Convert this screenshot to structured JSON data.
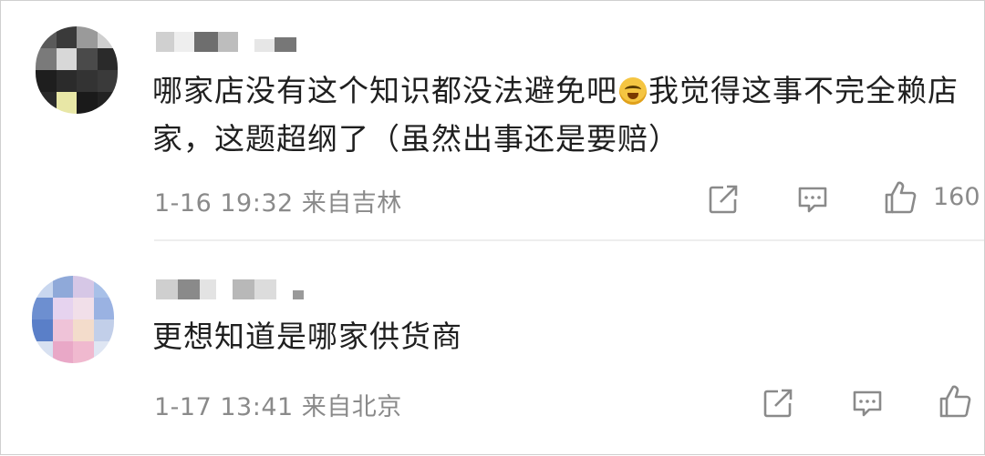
{
  "comments": [
    {
      "text_before_emoji": "哪家店没有这个知识都没法避免吧",
      "emoji": "laugh-cry-emoji",
      "text_after_emoji": "我觉得这事不完全赖店家，这题超纲了（虽然出事还是要赔）",
      "meta": "1-16 19:32 来自吉林",
      "like_count": "160"
    },
    {
      "text_before_emoji": "更想知道是哪家供货商",
      "meta": "1-17 13:41 来自北京",
      "like_count": ""
    }
  ],
  "colors": {
    "text": "#1f1f1f",
    "meta": "#8a8a8a",
    "icon": "#8a8a8a",
    "divider": "#eeeeee"
  },
  "icons": [
    "share-icon",
    "comment-icon",
    "like-icon"
  ]
}
